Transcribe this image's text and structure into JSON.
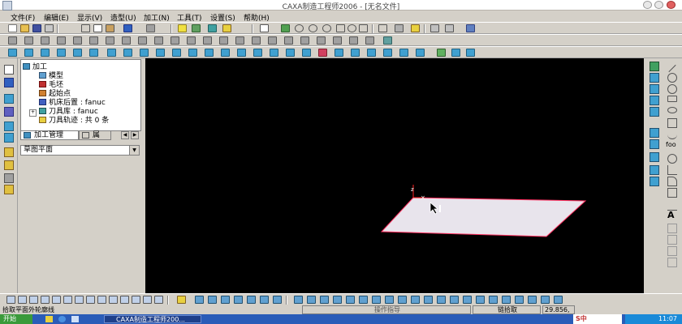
{
  "window": {
    "title": "CAXA制造工程师2006 - [无名文件]"
  },
  "menu": [
    "文件(F)",
    "编辑(E)",
    "显示(V)",
    "造型(U)",
    "加工(N)",
    "工具(T)",
    "设置(S)",
    "帮助(H)"
  ],
  "tree": {
    "root": "加工",
    "items": [
      "模型",
      "毛坯",
      "起始点",
      "机床后置 : fanuc",
      "刀具库 : fanuc",
      "刀具轨迹 : 共 0 条"
    ]
  },
  "tabs": {
    "active": "加工管理",
    "second": "属"
  },
  "combo": {
    "value": "草图平面"
  },
  "canvas": {
    "axis_label": "z"
  },
  "status": {
    "prompt": "拾取平面外轮廓线",
    "middle": "操作指导",
    "mode": "链拾取",
    "coords": "29.856,"
  },
  "taskbar": {
    "task": "CAXA制造工程师200...",
    "time": "11:07",
    "ime": "S中"
  },
  "colors": {
    "canvas": "#000000",
    "plane": "#e8e4ec",
    "plane_edge": "#ff3060",
    "titlebar": "#ffffff"
  }
}
